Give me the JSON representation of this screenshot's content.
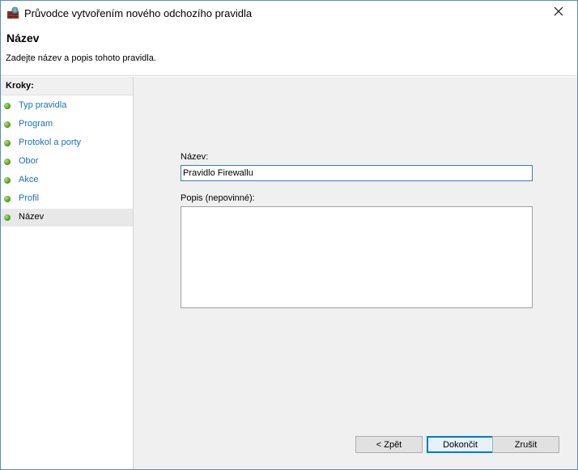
{
  "window": {
    "title": "Průvodce vytvořením nového odchozího pravidla"
  },
  "header": {
    "title": "Název",
    "subtitle": "Zadejte název a popis tohoto pravidla."
  },
  "sidebar": {
    "heading": "Kroky:",
    "steps": [
      {
        "label": "Typ pravidla",
        "active": false
      },
      {
        "label": "Program",
        "active": false
      },
      {
        "label": "Protokol a porty",
        "active": false
      },
      {
        "label": "Obor",
        "active": false
      },
      {
        "label": "Akce",
        "active": false
      },
      {
        "label": "Profil",
        "active": false
      },
      {
        "label": "Název",
        "active": true
      }
    ]
  },
  "form": {
    "name_label": "Název:",
    "name_value": "Pravidlo Firewallu",
    "description_label": "Popis (nepovinné):",
    "description_value": ""
  },
  "buttons": {
    "back": "< Zpět",
    "finish": "Dokončit",
    "cancel": "Zrušit"
  },
  "colors": {
    "step_link": "#1a6fc4",
    "step_dot": "#4c9a18",
    "content_bg": "#f0f0f0",
    "window_border": "#5a8ac6"
  },
  "icons": {
    "title": "firewall-wizard-icon",
    "close": "close-icon",
    "step": "green-dot-icon"
  }
}
